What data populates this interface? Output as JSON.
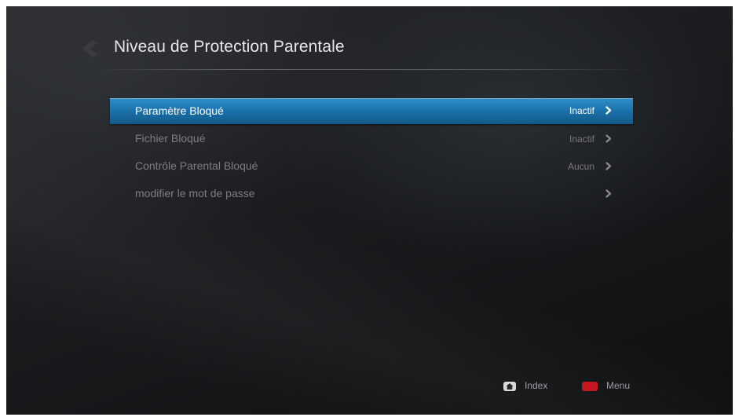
{
  "page": {
    "title": "Niveau de Protection Parentale",
    "back_icon": "chevron-left-icon"
  },
  "menu": {
    "items": [
      {
        "label": "Paramètre Bloqué",
        "value": "Inactif",
        "selected": true,
        "icon": "chevron-right-icon"
      },
      {
        "label": "Fichier Bloqué",
        "value": "Inactif",
        "selected": false,
        "icon": "chevron-right-icon"
      },
      {
        "label": "Contrôle Parental Bloqué",
        "value": "Aucun",
        "selected": false,
        "icon": "chevron-right-icon"
      },
      {
        "label": "modifier le mot de passe",
        "value": "",
        "selected": false,
        "icon": "chevron-right-icon"
      }
    ]
  },
  "footer": {
    "index": {
      "label": "Index",
      "icon": "home-key-icon"
    },
    "menu": {
      "label": "Menu",
      "icon": "red-key-icon",
      "color": "#c4121a"
    }
  },
  "colors": {
    "selection": "#1a6ea6",
    "background": "#1c1e21"
  }
}
